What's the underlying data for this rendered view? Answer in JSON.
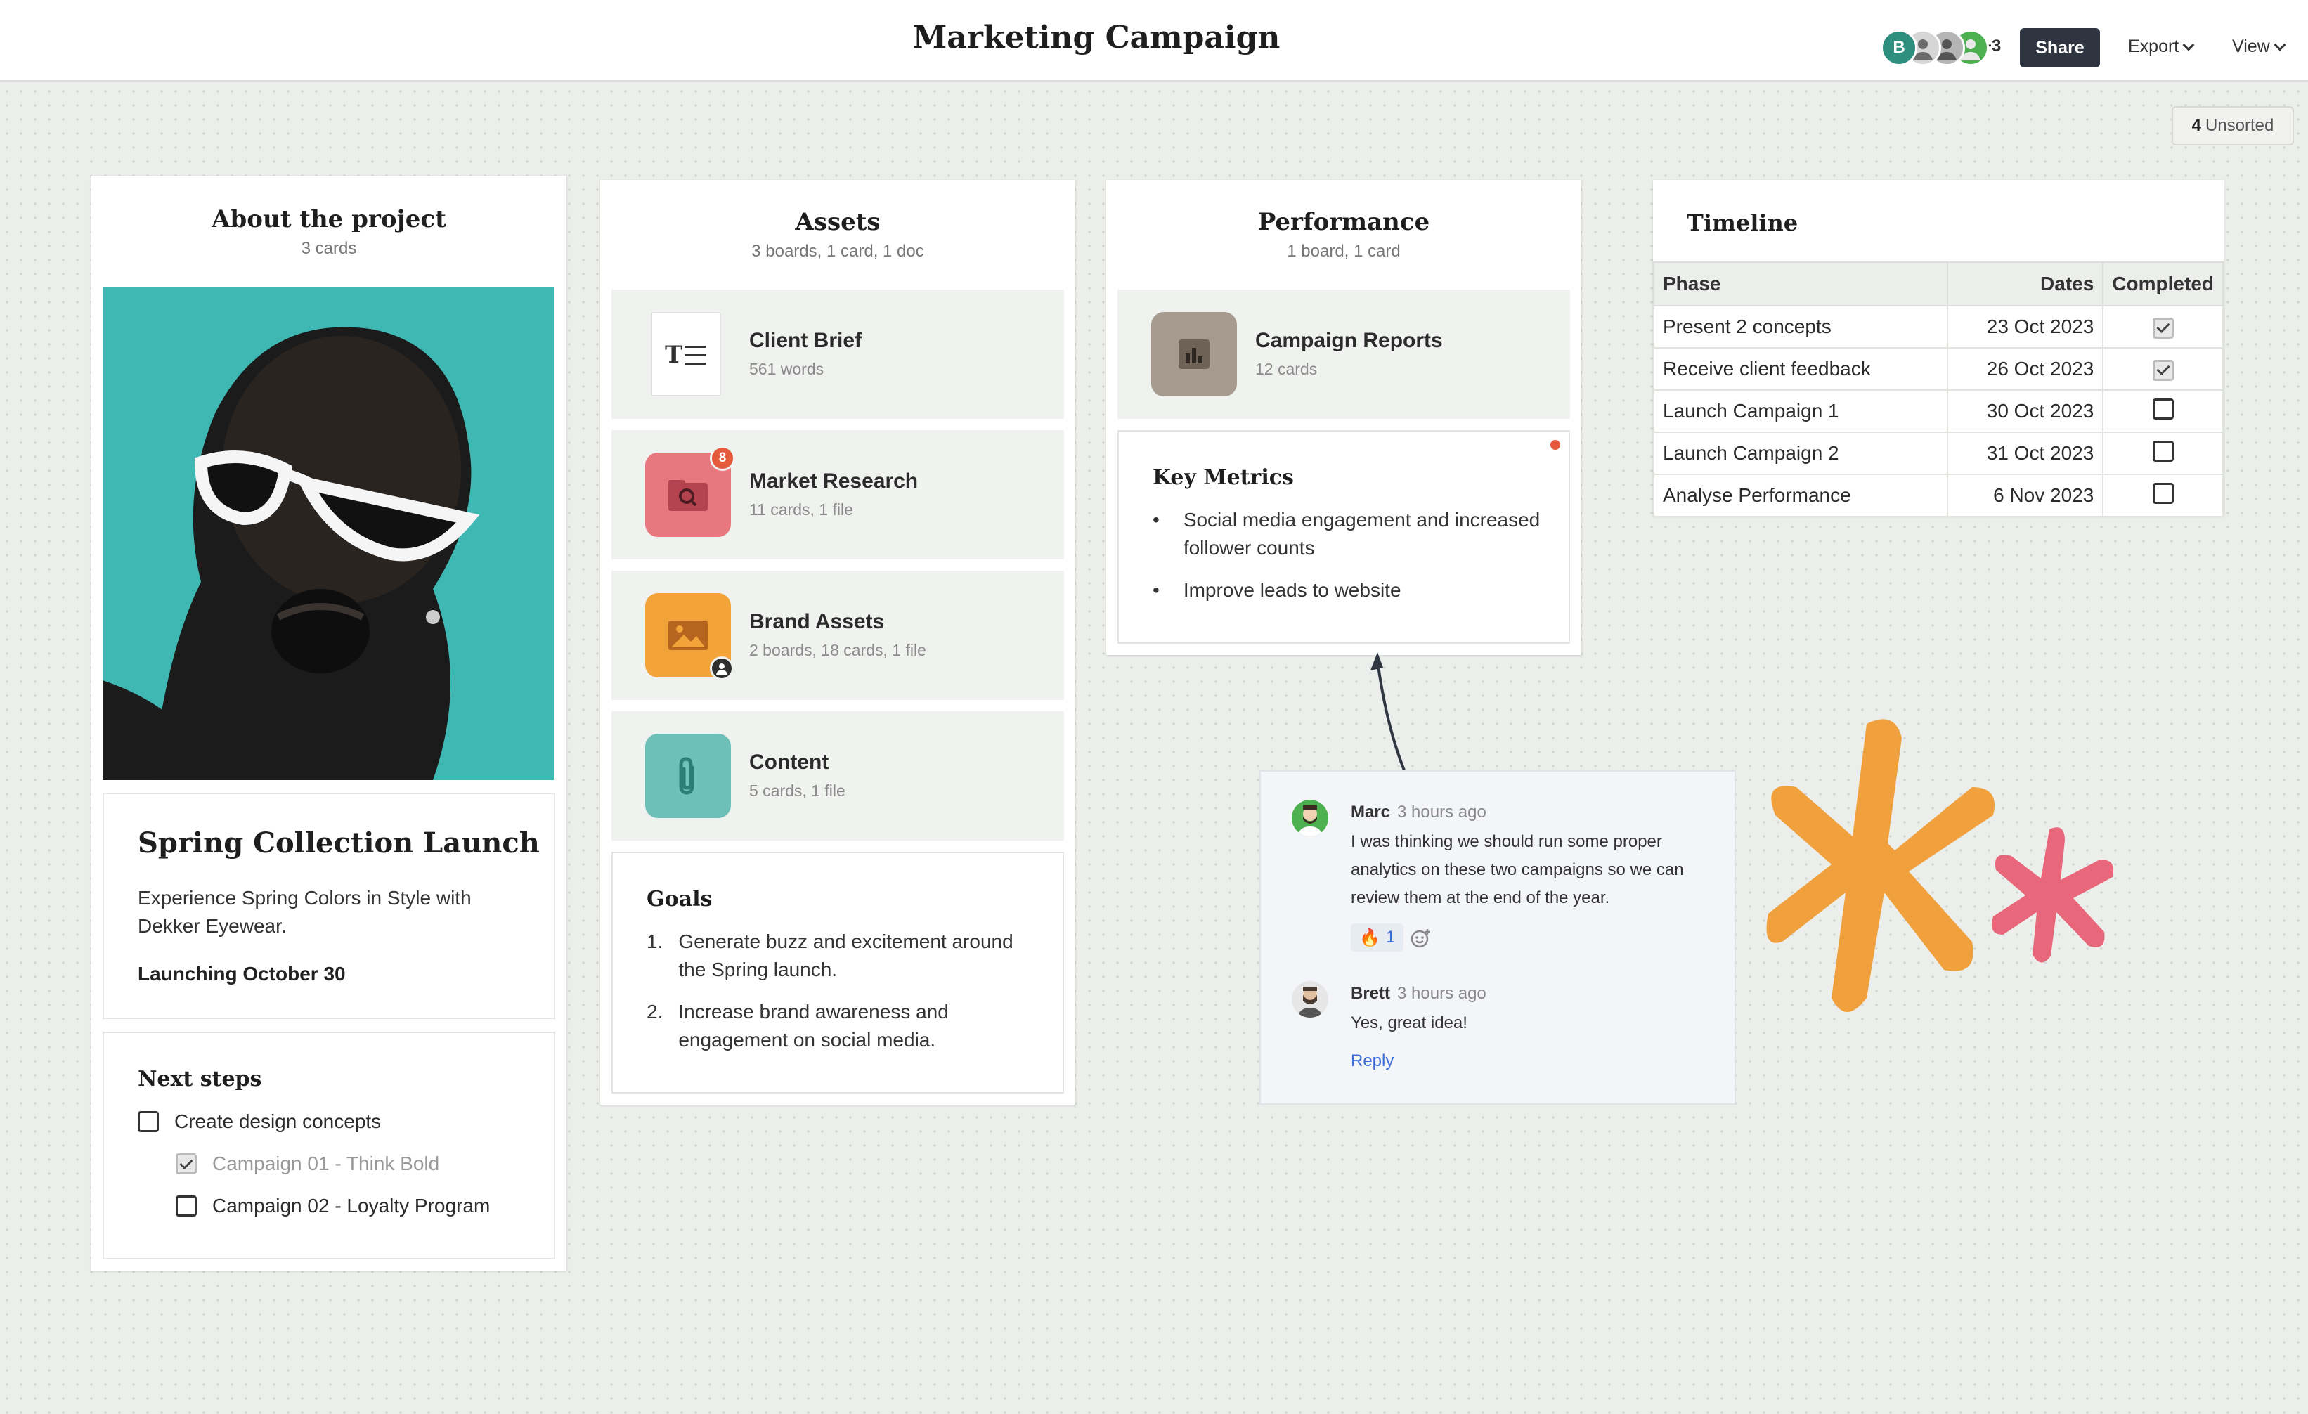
{
  "header": {
    "title": "Marketing Campaign",
    "collaborators": [
      {
        "initial": "B",
        "color": "#2f8f7f"
      },
      {
        "initial": "",
        "color": "#c9c9c9"
      },
      {
        "initial": "",
        "color": "#a0a0a0"
      },
      {
        "initial": "",
        "color": "#4caf50"
      }
    ],
    "more_collaborators": "+3",
    "share_label": "Share",
    "export_label": "Export",
    "view_label": "View"
  },
  "unsorted": {
    "count": "4",
    "label": "Unsorted"
  },
  "about": {
    "title": "About the project",
    "meta": "3 cards",
    "launch_title": "Spring Collection Launch",
    "description": "Experience Spring Colors in Style with Dekker Eyewear.",
    "launch_date": "Launching October 30",
    "next_steps_title": "Next steps",
    "todos": [
      {
        "label": "Create design concepts",
        "checked": false,
        "indent": 0
      },
      {
        "label": "Campaign 01 - Think Bold",
        "checked": true,
        "indent": 1
      },
      {
        "label": "Campaign 02 - Loyalty Program",
        "checked": false,
        "indent": 1
      }
    ]
  },
  "assets": {
    "title": "Assets",
    "meta": "3 boards, 1 card, 1 doc",
    "items": [
      {
        "name": "Client Brief",
        "meta": "561 words",
        "icon": "document-icon"
      },
      {
        "name": "Market Research",
        "meta": "11 cards, 1 file",
        "icon": "search-icon",
        "badge": "8",
        "color": "#e8787f"
      },
      {
        "name": "Brand Assets",
        "meta": "2 boards, 18 cards, 1 file",
        "icon": "image-icon",
        "color": "#f2a33a"
      },
      {
        "name": "Content",
        "meta": "5 cards, 1 file",
        "icon": "paperclip-icon",
        "color": "#6dbfb8"
      }
    ],
    "goals_title": "Goals",
    "goals": [
      {
        "num": "1.",
        "text": "Generate buzz and excitement around the Spring launch."
      },
      {
        "num": "2.",
        "text": "Increase brand awareness and engagement on social media."
      }
    ]
  },
  "performance": {
    "title": "Performance",
    "meta": "1 board, 1 card",
    "board": {
      "name": "Campaign Reports",
      "meta": "12 cards",
      "icon": "bar-chart-icon",
      "color": "#a79b8f"
    },
    "metrics_title": "Key Metrics",
    "metrics": [
      "Social media engagement and increased follower counts",
      "Improve leads to website"
    ]
  },
  "timeline": {
    "title": "Timeline",
    "columns": [
      "Phase",
      "Dates",
      "Completed"
    ],
    "rows": [
      {
        "phase": "Present 2 concepts",
        "date": "23 Oct 2023",
        "done": true
      },
      {
        "phase": "Receive client feedback",
        "date": "26 Oct 2023",
        "done": true
      },
      {
        "phase": "Launch Campaign 1",
        "date": "30 Oct 2023",
        "done": false
      },
      {
        "phase": "Launch Campaign 2",
        "date": "31 Oct 2023",
        "done": false
      },
      {
        "phase": "Analyse Performance",
        "date": "6 Nov 2023",
        "done": false
      }
    ]
  },
  "comments": [
    {
      "author": "Marc",
      "time": "3 hours ago",
      "text": "I was thinking we should run some proper analytics on these two campaigns so we can review them at the end of the year.",
      "reaction": "🔥",
      "reaction_count": "1"
    },
    {
      "author": "Brett",
      "time": "3 hours ago",
      "text": "Yes, great idea!"
    }
  ],
  "reply_label": "Reply",
  "colors": {
    "accent_dark": "#2e3440",
    "orange": "#f0a03c",
    "pink": "#e8677a",
    "teal": "#3fb7b3"
  }
}
